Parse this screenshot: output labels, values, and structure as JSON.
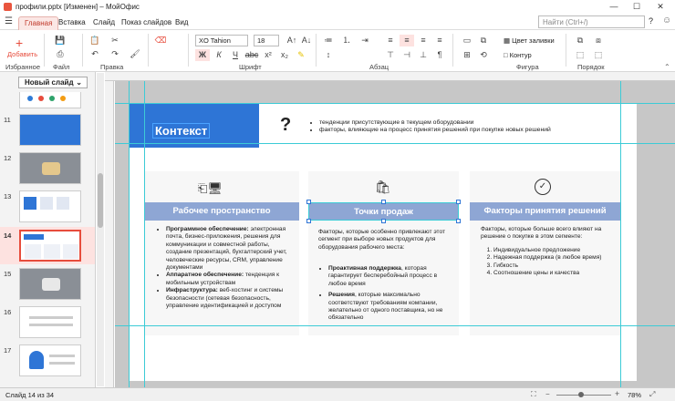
{
  "window": {
    "title": "профили.pptx [Изменен] – МойОфис"
  },
  "tabs": [
    {
      "label": "Главная"
    },
    {
      "label": "Вставка"
    },
    {
      "label": "Слайд"
    },
    {
      "label": "Показ слайдов"
    },
    {
      "label": "Вид"
    }
  ],
  "search": {
    "placeholder": "Найти (Ctrl+/)"
  },
  "ribbon": {
    "add_label": "Добавить",
    "groups": {
      "favorites": "Избранное",
      "file": "Файл",
      "edit": "Правка",
      "font": "Шрифт",
      "paragraph": "Абзац",
      "shape": "Фигура",
      "order": "Порядок"
    },
    "font_name": "XO Tahion",
    "font_size": "18",
    "fill_color": "Цвет заливки",
    "outline": "Контур"
  },
  "slides_panel": {
    "new_slide_label": "Новый слайд",
    "numbers": [
      "11",
      "12",
      "13",
      "14",
      "15",
      "16",
      "17"
    ],
    "selected": "14"
  },
  "slide": {
    "context_title": "Контекст",
    "question_mark": "?",
    "context_bullets": [
      "тенденции присутствующие в текущем оборудовании",
      "факторы, влияющие на процесс принятия решений при покупке новых решений"
    ],
    "columns": [
      {
        "title": "Рабочее пространство",
        "items": [
          {
            "bold": "Программное обеспечение:",
            "rest": " электронная почта, бизнес-приложения, решения для коммуникации и совместной работы, создание презентаций, бухгалтерский учет, человеческие ресурсы, CRM, управление документами"
          },
          {
            "bold": "Аппаратное обеспечение:",
            "rest": " тенденция к мобильным устройствам"
          },
          {
            "bold": "Инфраструктура:",
            "rest": " веб-хостинг и системы безопасности (сетевая безопасность, управление идентификацией и доступом"
          }
        ]
      },
      {
        "title": "Точки продаж",
        "intro": "Факторы, которые особенно привлекают этот сегмент при выборе новых продуктов для оборудования рабочего места:",
        "items": [
          {
            "bold": "Проактивная поддержка",
            "rest": ", которая гарантирует бесперебойный процесс в любое время"
          },
          {
            "bold": "Решения",
            "rest": ", которые максимально соответствуют требованиям компании, желательно от одного поставщика, но не обязательно"
          }
        ]
      },
      {
        "title": "Факторы принятия решений",
        "intro": "Факторы, которые больше всего влияют на решение о покупке в этом сегменте:",
        "items": [
          "Индивидуальное предложение",
          "Надежная поддержка (в любое время)",
          "Гибкость",
          "Соотношение цены и качества"
        ]
      }
    ]
  },
  "status": {
    "slide_counter": "Слайд 14 из 34",
    "zoom": "78%"
  }
}
